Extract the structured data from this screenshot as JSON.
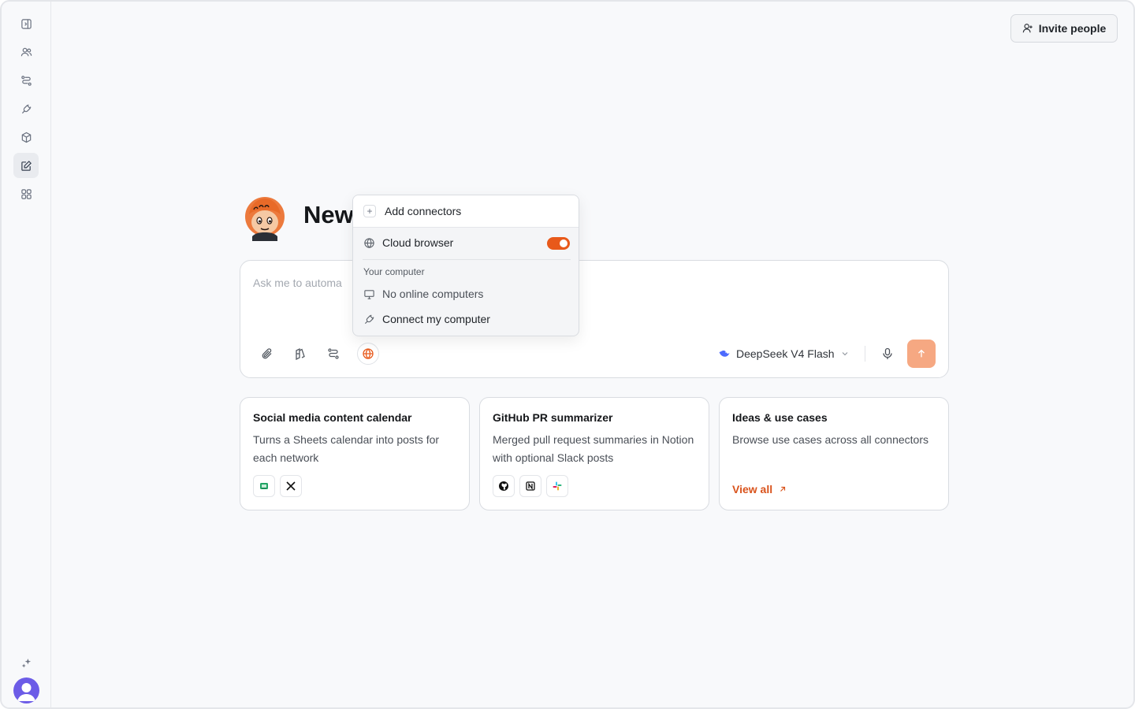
{
  "header": {
    "invite_label": "Invite people"
  },
  "sidebar": {
    "items": [
      {
        "name": "panel-toggle-icon"
      },
      {
        "name": "people-icon"
      },
      {
        "name": "workflow-icon"
      },
      {
        "name": "plug-icon"
      },
      {
        "name": "cube-icon"
      },
      {
        "name": "edit-icon",
        "active": true
      },
      {
        "name": "apps-grid-icon"
      }
    ],
    "bottom": [
      {
        "name": "sparkle-icon"
      },
      {
        "name": "avatar"
      }
    ]
  },
  "main": {
    "title": "New",
    "composer": {
      "placeholder": "Ask me to automa",
      "model": "DeepSeek V4 Flash"
    },
    "cards": [
      {
        "title": "Social media content calendar",
        "description": "Turns a Sheets calendar into posts for each network",
        "icons": [
          "sheets-icon",
          "x-icon"
        ]
      },
      {
        "title": "GitHub PR summarizer",
        "description": "Merged pull request summaries in Notion with optional Slack posts",
        "icons": [
          "github-icon",
          "notion-icon",
          "slack-icon"
        ]
      },
      {
        "title": "Ideas & use cases",
        "description": "Browse use cases across all connectors",
        "link": "View all"
      }
    ]
  },
  "connectors_menu": {
    "add_label": "Add connectors",
    "cloud_browser_label": "Cloud browser",
    "cloud_browser_enabled": true,
    "section_label": "Your computer",
    "no_computers_label": "No online computers",
    "connect_label": "Connect my computer"
  },
  "colors": {
    "accent": "#e8591a",
    "send_button": "#f6a882",
    "link": "#d9531c"
  }
}
